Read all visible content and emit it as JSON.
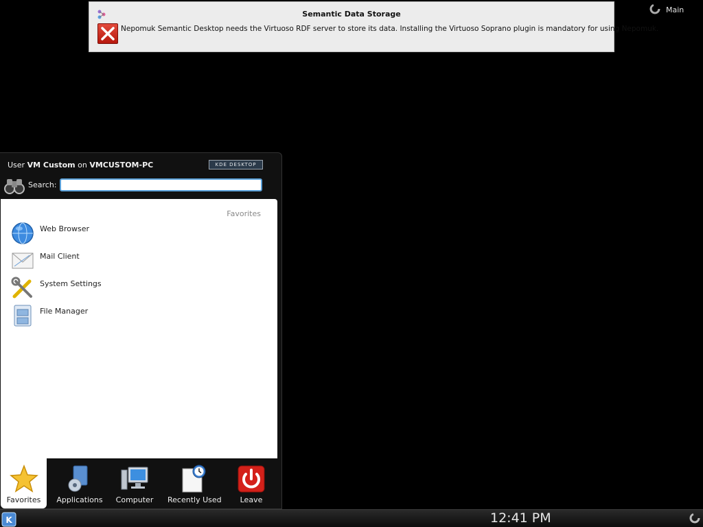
{
  "notification": {
    "title": "Semantic Data Storage",
    "message": "Nepomuk Semantic Desktop needs the Virtuoso RDF server to store its data. Installing the Virtuoso Soprano plugin is mandatory for using Nepomuk."
  },
  "activity": {
    "label": "Main"
  },
  "kickoff": {
    "header": {
      "prefix": "User ",
      "user": "VM Custom",
      "on": " on ",
      "host": "VMCUSTOM-PC"
    },
    "kde_badge": "KDE DESKTOP",
    "search": {
      "label": "Search:",
      "value": "",
      "placeholder": ""
    },
    "section_title": "Favorites",
    "favorites": [
      {
        "label": "Web Browser",
        "icon": "globe-icon"
      },
      {
        "label": "Mail Client",
        "icon": "mail-icon"
      },
      {
        "label": "System Settings",
        "icon": "tools-icon"
      },
      {
        "label": "File Manager",
        "icon": "file-manager-icon"
      }
    ],
    "tabs": [
      {
        "label": "Favorites",
        "icon": "star-icon",
        "active": true
      },
      {
        "label": "Applications",
        "icon": "applications-icon"
      },
      {
        "label": "Computer",
        "icon": "computer-icon"
      },
      {
        "label": "Recently Used",
        "icon": "recent-icon"
      },
      {
        "label": "Leave",
        "icon": "power-icon"
      }
    ]
  },
  "panel": {
    "clock": "12:41 PM"
  }
}
